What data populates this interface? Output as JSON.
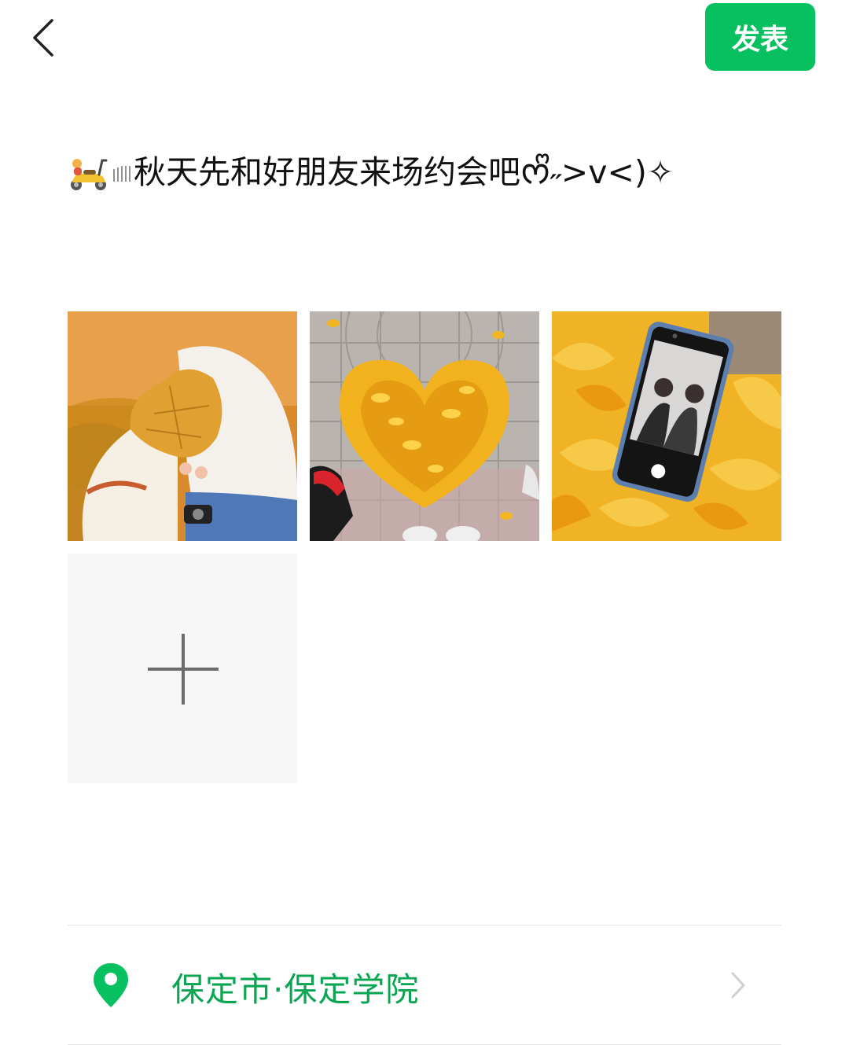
{
  "header": {
    "back_icon": "chevron-left-icon",
    "publish_label": "发表",
    "accent_color": "#07c160"
  },
  "post": {
    "text": "秋天先和好朋友来场约会吧ᰔᩚ˶>v<)✧",
    "leading_icons": [
      "scooter-emoji-icon",
      "speed-lines-icon"
    ]
  },
  "photos": [
    {
      "name": "photo-autumn-leaf-couple"
    },
    {
      "name": "photo-heart-of-ginkgo-leaves"
    },
    {
      "name": "photo-phone-on-leaves"
    }
  ],
  "add_tile": {
    "icon": "plus-icon"
  },
  "location": {
    "icon": "location-pin-icon",
    "text": "保定市·保定学院",
    "color": "#09a551",
    "chevron": "chevron-right-icon"
  }
}
